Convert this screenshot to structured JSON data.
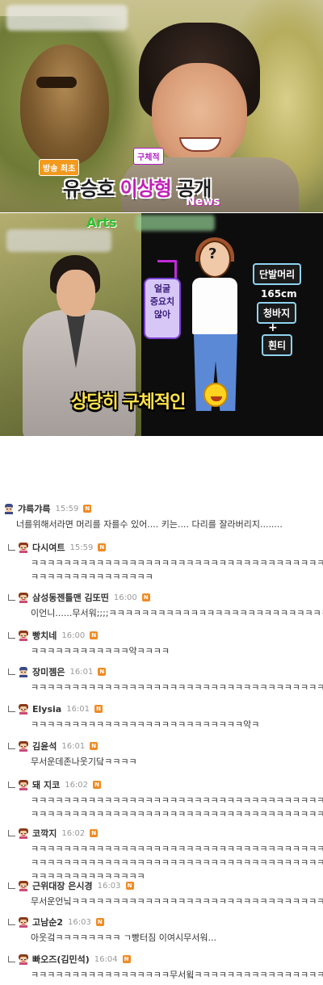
{
  "frame1": {
    "tag_small_1": "방송 최초",
    "tag_small_2": "구체적",
    "caption_part_a": "유승호 ",
    "caption_part_b": "이상형",
    "caption_part_c": " 공개",
    "watermark": "News"
  },
  "frame2": {
    "brand": "Arts",
    "face_note": [
      "얼굴",
      "중요치",
      "않아"
    ],
    "labels": {
      "short_hair": "단발머리",
      "height": "165cm",
      "jeans": "청바지",
      "plus": "+",
      "white_tee": "흰티"
    },
    "bottom_text": "상당히 구체적인"
  },
  "comments": [
    {
      "nick": "갸륵갸륵",
      "time": "15:59",
      "reply": false,
      "avatar": "knight-avatar",
      "lines": [
        "너를위해서라면 머리를 자를수 있어.... 키는.... 다리를 잘라버리지........"
      ]
    },
    {
      "nick": "다시여트",
      "time": "15:59",
      "reply": true,
      "avatar": "girl-avatar",
      "lines": [
        "ㅋㅋㅋㅋㅋㅋㅋㅋㅋㅋㅋㅋㅋㅋㅋㅋㅋㅋㅋㅋㅋㅋㅋㅋㅋㅋㅋㅋㅋㅋㅋㅋㅋㅋㅋㅋ시",
        "ㅋㅋㅋㅋㅋㅋㅋㅋㅋㅋㅋㅋㅋㅋㅋ"
      ]
    },
    {
      "nick": "삼성동젠틀맨 김또띤",
      "time": "16:00",
      "reply": true,
      "avatar": "girl-avatar",
      "lines": [
        "이언니......무서워;;;;ㅋㅋㅋㅋㅋㅋㅋㅋㅋㅋㅋㅋㅋㅋㅋㅋㅋㅋㅋㅋㅋㅋㅋㅋㅋㅋㅋㅋ"
      ]
    },
    {
      "nick": "빵치네",
      "time": "16:00",
      "reply": true,
      "avatar": "girl-avatar",
      "lines": [
        "ㅋㅋㅋㅋㅋㅋㅋㅋㅋㅋㅋㅋ악ㅋㅋㅋㅋ"
      ]
    },
    {
      "nick": "장미젬은",
      "time": "16:01",
      "reply": true,
      "avatar": "knight-avatar",
      "lines": [
        "ㅋㅋㅋㅋㅋㅋㅋㅋㅋㅋㅋㅋㅋㅋㅋㅋㅋㅋㅋㅋㅋㅋㅋㅋㅋㅋㅋㅋㅋㅋㅋㅋㅋㅋㅋㅋㅋ"
      ]
    },
    {
      "nick": "Elysia",
      "time": "16:01",
      "reply": true,
      "avatar": "girl-avatar",
      "lines": [
        "ㅋㅋㅋㅋㅋㅋㅋㅋㅋㅋㅋㅋㅋㅋㅋㅋㅋㅋㅋㅋㅋㅋㅋㅋㅋㅋ악ㅋ"
      ]
    },
    {
      "nick": "김윤석",
      "time": "16:01",
      "reply": true,
      "avatar": "girl-avatar",
      "lines": [
        "무서운데존나웃기닼ㅋㅋㅋㅋ"
      ]
    },
    {
      "nick": "돼 지코",
      "time": "16:02",
      "reply": true,
      "avatar": "girl-avatar",
      "lines": [
        "ㅋㅋㅋㅋㅋㅋㅋㅋㅋㅋㅋㅋㅋㅋㅋㅋㅋㅋㅋㅋㅋㅋㅋㅋㅋㅋㅋㅋㅋㅋㅋㅋㅋㅋㅋㅋㅋ",
        "ㅋㅋㅋㅋㅋㅋㅋㅋㅋㅋㅋㅋㅋㅋㅋㅋㅋㅋㅋㅋㅋㅋㅋㅋㅋㅋㅋㅋㅋㅋㅋㅋㅋㅋㅋㅋㅋ"
      ]
    },
    {
      "nick": "코깍지",
      "time": "16:02",
      "reply": true,
      "avatar": "girl-avatar",
      "lines": [
        "ㅋㅋㅋㅋㅋㅋㅋㅋㅋㅋㅋㅋㅋㅋㅋㅋㅋㅋㅋㅋㅋㅋㅋㅋㅋㅋㅋㅋㅋㅋㅋㅋㅋㅋㅋㅋㅋ",
        "ㅋㅋㅋㅋㅋㅋㅋㅋㅋㅋㅋㅋㅋㅋㅋㅋㅋㅋㅋㅋㅋㅋㅋㅋㅋㅋㅋㅋㅋㅋㅋㅋㅋㅋㅋㅋㅋ",
        "ㅋㅋㅋㅋㅋㅋㅋㅋㅋㅋㅋㅋㅋㅋ"
      ]
    },
    {
      "nick": "근위대장 은시경",
      "time": "16:03",
      "reply": true,
      "avatar": "girl-avatar",
      "lines": [
        "무서운언닠ㅋㅋㅋㅋㅋㅋㅋㅋㅋㅋㅋㅋㅋㅋㅋㅋㅋㅋㅋㅋㅋㅋㅋㅋㅋㅋㅋㅋㅋㅋㅋㅋ"
      ]
    },
    {
      "nick": "고남순2",
      "time": "16:03",
      "reply": true,
      "avatar": "girl-avatar",
      "lines": [
        "아웃겈ㅋㅋㅋㅋㅋㅋㅋㅋ ㄱ빵터짐 이여시무서워..."
      ]
    },
    {
      "nick": "빠오즈(김민석)",
      "time": "16:04",
      "reply": true,
      "avatar": "girl-avatar",
      "lines": [
        "ㅋㅋㅋㅋㅋㅋㅋㅋㅋㅋㅋㅋㅋㅋㅋㅋㅋ무서윜ㅋㅋㅋㅋㅋㅋㅋㅋㅋㅋㅋㅋㅋㅋㅋㅋ"
      ]
    }
  ],
  "badge_label": "N",
  "colors": {
    "nick": "#333333",
    "time": "#999999",
    "badge": "#f08b25",
    "caption_pink": "#c21fb8",
    "caption_yellow": "#ffe24a"
  }
}
